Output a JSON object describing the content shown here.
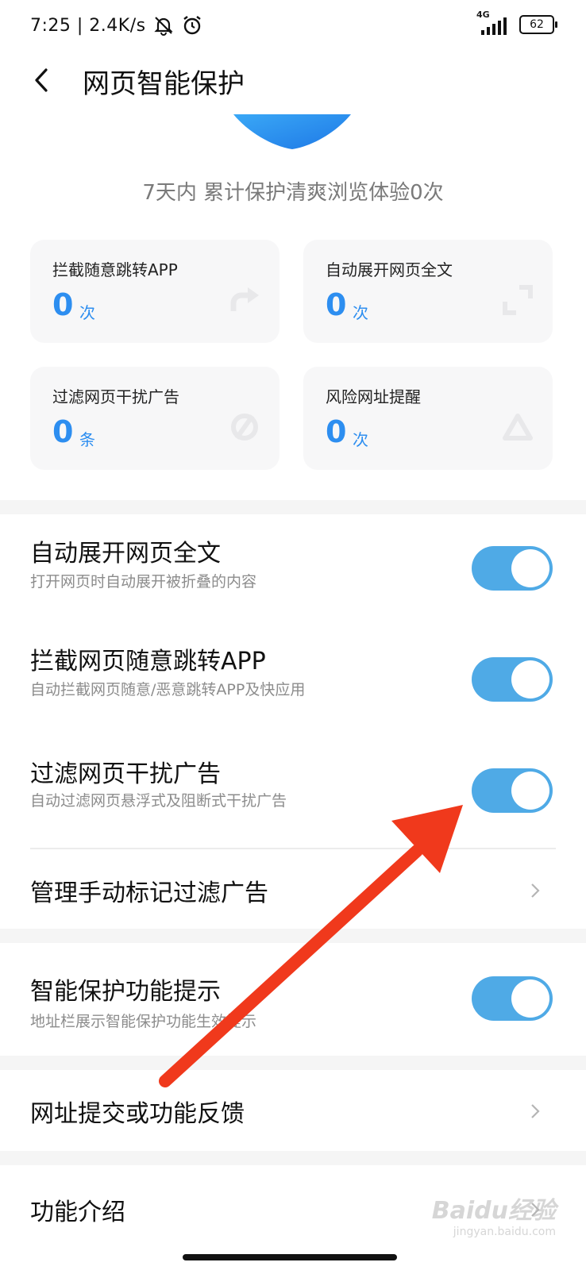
{
  "status_bar": {
    "time_speed": "7:25 | 2.4K/s",
    "network": "4G",
    "battery": "62"
  },
  "header": {
    "title": "网页智能保护"
  },
  "summary": "7天内 累计保护清爽浏览体验0次",
  "stats": [
    {
      "label": "拦截随意跳转APP",
      "value": "0",
      "unit": "次",
      "icon": "redirect-arrow-icon"
    },
    {
      "label": "自动展开网页全文",
      "value": "0",
      "unit": "次",
      "icon": "expand-corners-icon"
    },
    {
      "label": "过滤网页干扰广告",
      "value": "0",
      "unit": "条",
      "icon": "block-circle-icon"
    },
    {
      "label": "风险网址提醒",
      "value": "0",
      "unit": "次",
      "icon": "warning-triangle-icon"
    }
  ],
  "settings": {
    "expand": {
      "title": "自动展开网页全文",
      "sub": "打开网页时自动展开被折叠的内容",
      "on": true
    },
    "block_redirect": {
      "title": "拦截网页随意跳转APP",
      "sub": "自动拦截网页随意/恶意跳转APP及快应用",
      "on": true
    },
    "filter_ads": {
      "title": "过滤网页干扰广告",
      "sub": "自动过滤网页悬浮式及阻断式干扰广告",
      "on": true
    },
    "manage_ads": {
      "title": "管理手动标记过滤广告"
    },
    "hint": {
      "title": "智能保护功能提示",
      "sub": "地址栏展示智能保护功能生效提示",
      "on": true
    },
    "feedback": {
      "title": "网址提交或功能反馈"
    },
    "intro": {
      "title": "功能介绍"
    }
  },
  "watermark": {
    "main": "Baidu经验",
    "sub": "jingyan.baidu.com"
  },
  "colors": {
    "accent": "#2d8ef0",
    "toggle": "#4faae6",
    "arrow": "#f0391c"
  }
}
